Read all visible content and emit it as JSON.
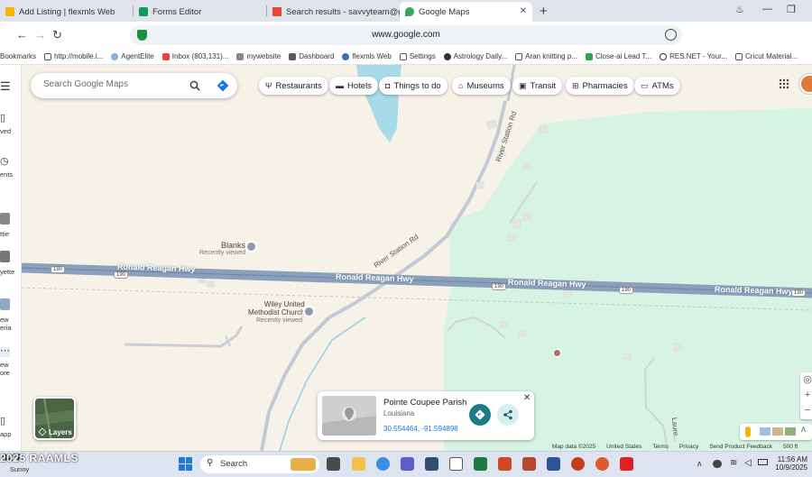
{
  "browser": {
    "tabs": [
      {
        "title": "Add Listing | flexmls Web",
        "icon": "flexmls-icon",
        "active": false
      },
      {
        "title": "Forms Editor",
        "icon": "forms-icon",
        "active": false
      },
      {
        "title": "Search results - savvyteam@gmail",
        "icon": "gmail-icon",
        "active": false
      },
      {
        "title": "Google Maps",
        "icon": "maps-icon",
        "active": true
      }
    ],
    "new_tab": "+",
    "url": "www.google.com",
    "bookmarks": [
      {
        "label": "Bookmarks"
      },
      {
        "label": "http://mobile.l..."
      },
      {
        "label": "AgentElite"
      },
      {
        "label": "Inbox (803,131)..."
      },
      {
        "label": "mywebsite"
      },
      {
        "label": "Dashboard"
      },
      {
        "label": "flexmls Web"
      },
      {
        "label": "Settings"
      },
      {
        "label": "Astrology Daily..."
      },
      {
        "label": "Aran knitting p..."
      },
      {
        "label": "Close-ai Lead T..."
      },
      {
        "label": "RES.NET - Your..."
      },
      {
        "label": "Cricut Material..."
      }
    ]
  },
  "maps": {
    "search_placeholder": "Search Google Maps",
    "chips": [
      "Restaurants",
      "Hotels",
      "Things to do",
      "Museums",
      "Transit",
      "Pharmacies",
      "ATMs"
    ],
    "left_rail": [
      {
        "label": "ved",
        "icon": "bookmark-icon"
      },
      {
        "label": "ents",
        "icon": "history-icon"
      },
      {
        "label": "ttie",
        "icon": "place-icon"
      },
      {
        "label": "yette",
        "icon": "place-icon"
      },
      {
        "label": "ew\neria",
        "icon": "place-icon"
      },
      {
        "label": "ew\nore",
        "icon": "more-icon"
      },
      {
        "label": "app",
        "icon": "phone-icon"
      }
    ],
    "labels": {
      "road_main": "Ronald Reagan Hwy",
      "shield": "190",
      "river_station": "River Station Rd",
      "place1_name": "Blanks",
      "place1_sub": "Recently viewed",
      "place2_name": "Wiley United\nMethodist Church",
      "place2_sub": "Recently viewed",
      "street_small": "Laure..."
    },
    "place_card": {
      "title": "Pointe Coupee Parish",
      "subtitle": "Louisiana",
      "coords": "30.554464, -91.594898"
    },
    "layers_label": "Layers",
    "attribution": [
      "Map data ©2025",
      "United States",
      "Terms",
      "Privacy",
      "Send Product Feedback",
      "500 ft"
    ]
  },
  "taskbar": {
    "weather_temp": "82°F",
    "weather_desc": "Sunny",
    "search_label": "Search",
    "time": "11:56 AM",
    "date": "10/9/2025"
  },
  "watermark": "2025 RAAMLS",
  "colors": {
    "water": "#a8dbea",
    "park": "#d6f3e3",
    "highway": "#8aa0bd",
    "highway_center": "#6f85a3",
    "accent": "#1a73e8"
  }
}
